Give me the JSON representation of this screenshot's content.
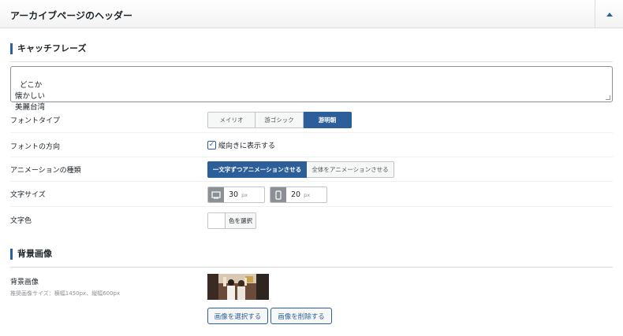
{
  "header": {
    "title": "アーカイブページのヘッダー"
  },
  "catchphrase": {
    "heading": "キャッチフレーズ",
    "text": "どこか\n懐かしい\n美麗台湾"
  },
  "font_type": {
    "label": "フォントタイプ",
    "options": [
      "メイリオ",
      "游ゴシック",
      "游明朝"
    ],
    "selected": "游明朝"
  },
  "font_direction": {
    "label": "フォントの方向",
    "checkbox_label": "縦向きに表示する",
    "checked": true
  },
  "animation": {
    "label": "アニメーションの種類",
    "options": [
      "一文字ずつアニメーションさせる",
      "全体をアニメーションさせる"
    ],
    "selected": "一文字ずつアニメーションさせる"
  },
  "font_size": {
    "label": "文字サイズ",
    "desktop_value": "30",
    "mobile_value": "20",
    "unit": "px"
  },
  "text_color": {
    "label": "文字色",
    "button_label": "色を選択",
    "value": "#ffffff"
  },
  "background": {
    "heading": "背景画像",
    "label": "背景画像",
    "hint": "推奨画像サイズ：横幅1450px、縦幅600px",
    "select_button": "画像を選択する",
    "delete_button": "画像を削除する"
  },
  "colors": {
    "accent": "#2c5e99",
    "border": "#c3c4c7"
  },
  "icons": {
    "collapse": "triangle-up-icon",
    "desktop": "desktop-icon",
    "mobile": "mobile-icon",
    "check": "check-icon"
  }
}
